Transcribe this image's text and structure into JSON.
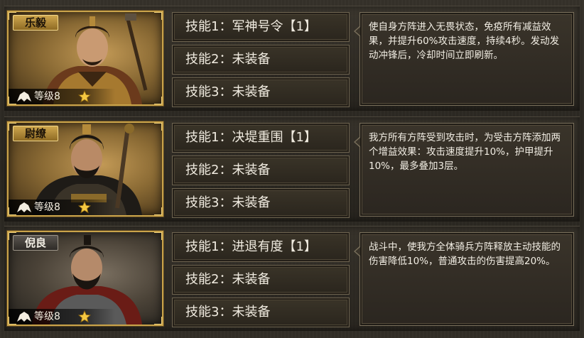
{
  "generals": [
    {
      "name": "乐毅",
      "level_label": "等级8",
      "name_style": "gold",
      "skills": [
        "技能1：军神号令【1】",
        "技能2：未装备",
        "技能3：未装备"
      ],
      "description": "使自身方阵进入无畏状态，免疫所有减益效果，并提升60%攻击速度，持续4秒。发动发动冲锋后，冷却时间立即刷新。"
    },
    {
      "name": "尉缭",
      "level_label": "等级8",
      "name_style": "gold",
      "skills": [
        "技能1：决堤重围【1】",
        "技能2：未装备",
        "技能3：未装备"
      ],
      "description": "我方所有方阵受到攻击时，为受击方阵添加两个增益效果：攻击速度提升10%，护甲提升10%，最多叠加3层。"
    },
    {
      "name": "倪良",
      "level_label": "等级8",
      "name_style": "gray",
      "skills": [
        "技能1：进退有度【1】",
        "技能2：未装备",
        "技能3：未装备"
      ],
      "description": "战斗中，使我方全体骑兵方阵释放主动技能的伤害降低10%，普通攻击的伤害提高20%。"
    }
  ],
  "colors": {
    "gold_frame": "#c9a34a",
    "panel_border": "#7a705c",
    "text": "#f2eee4",
    "star": "#f5c842"
  },
  "icons": [
    "helmet-class-icon",
    "star-icon"
  ]
}
